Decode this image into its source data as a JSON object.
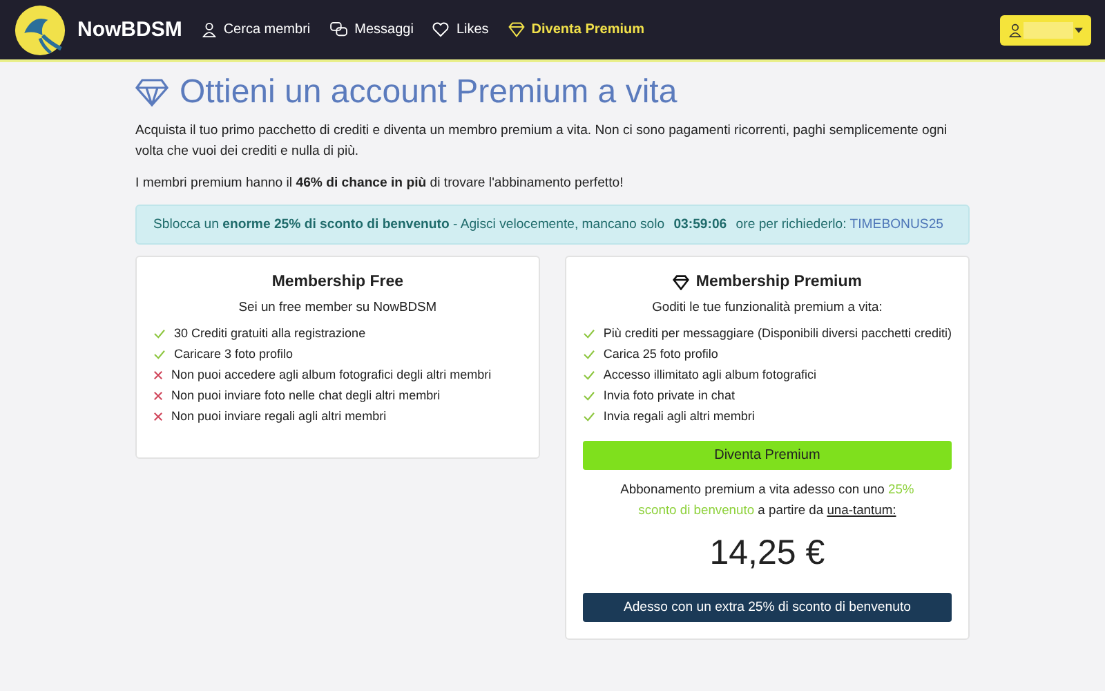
{
  "header": {
    "brand": "NowBDSM",
    "nav": [
      {
        "label": "Cerca membri",
        "highlighted": false
      },
      {
        "label": "Messaggi",
        "highlighted": false
      },
      {
        "label": "Likes",
        "highlighted": false
      },
      {
        "label": "Diventa Premium",
        "highlighted": true
      }
    ]
  },
  "title": "Ottieni un account Premium a vita",
  "intro": "Acquista il tuo primo pacchetto di crediti e diventa un membro premium a vita. Non ci sono pagamenti ricorrenti, paghi semplicemente ogni volta che vuoi dei crediti e nulla di più.",
  "stat": "I membri premium hanno il **46% di chance in più** di trovare l'abbinamento perfetto!",
  "alert": {
    "parts": [
      {
        "kind": "plain",
        "text": "Sblocca un "
      },
      {
        "kind": "bold",
        "text": "enorme 25% di sconto di benvenuto"
      },
      {
        "kind": "plain",
        "text": " - Agisci velocemente, mancano solo "
      },
      {
        "kind": "timer",
        "text": "03:59:06"
      },
      {
        "kind": "plain",
        "text": " ore per richiederlo: "
      },
      {
        "kind": "code",
        "text": "TIMEBONUS25"
      }
    ]
  },
  "plans": [
    {
      "kind": "free",
      "title": "Membership Free",
      "subtitle": "Sei un free member su NowBDSM",
      "features": [
        {
          "text": "30 Crediti gratuiti alla registrazione",
          "included": true
        },
        {
          "text": "Caricare 3 foto profilo",
          "included": true
        },
        {
          "text": "Non puoi accedere agli album fotografici degli altri membri",
          "included": false
        },
        {
          "text": "Non puoi inviare foto nelle chat degli altri membri",
          "included": false
        },
        {
          "text": "Non puoi inviare regali agli altri membri",
          "included": false
        }
      ]
    },
    {
      "kind": "premium",
      "title": "Membership Premium",
      "subtitle": "Goditi le tue funzionalità premium a vita:",
      "features": [
        {
          "text": "Più crediti per messaggiare (Disponibili diversi pacchetti crediti)",
          "included": true
        },
        {
          "text": "Carica 25 foto profilo",
          "included": true
        },
        {
          "text": "Accesso illimitato agli album fotografici",
          "included": true
        },
        {
          "text": "Invia foto private in chat",
          "included": true
        },
        {
          "text": "Invia regali agli altri membri",
          "included": true
        }
      ],
      "button": "Diventa Premium",
      "offer": [
        {
          "kind": "plain",
          "text": "Abbonamento premium a vita adesso con uno "
        },
        {
          "kind": "highlight",
          "text": "25% sconto di benvenuto"
        },
        {
          "kind": "plain",
          "text": " a partire da "
        },
        {
          "kind": "underline",
          "text": "una-tantum:"
        }
      ],
      "price": "14,25 €",
      "extra_button": "Adesso con un extra 25% di sconto di benvenuto"
    }
  ]
}
